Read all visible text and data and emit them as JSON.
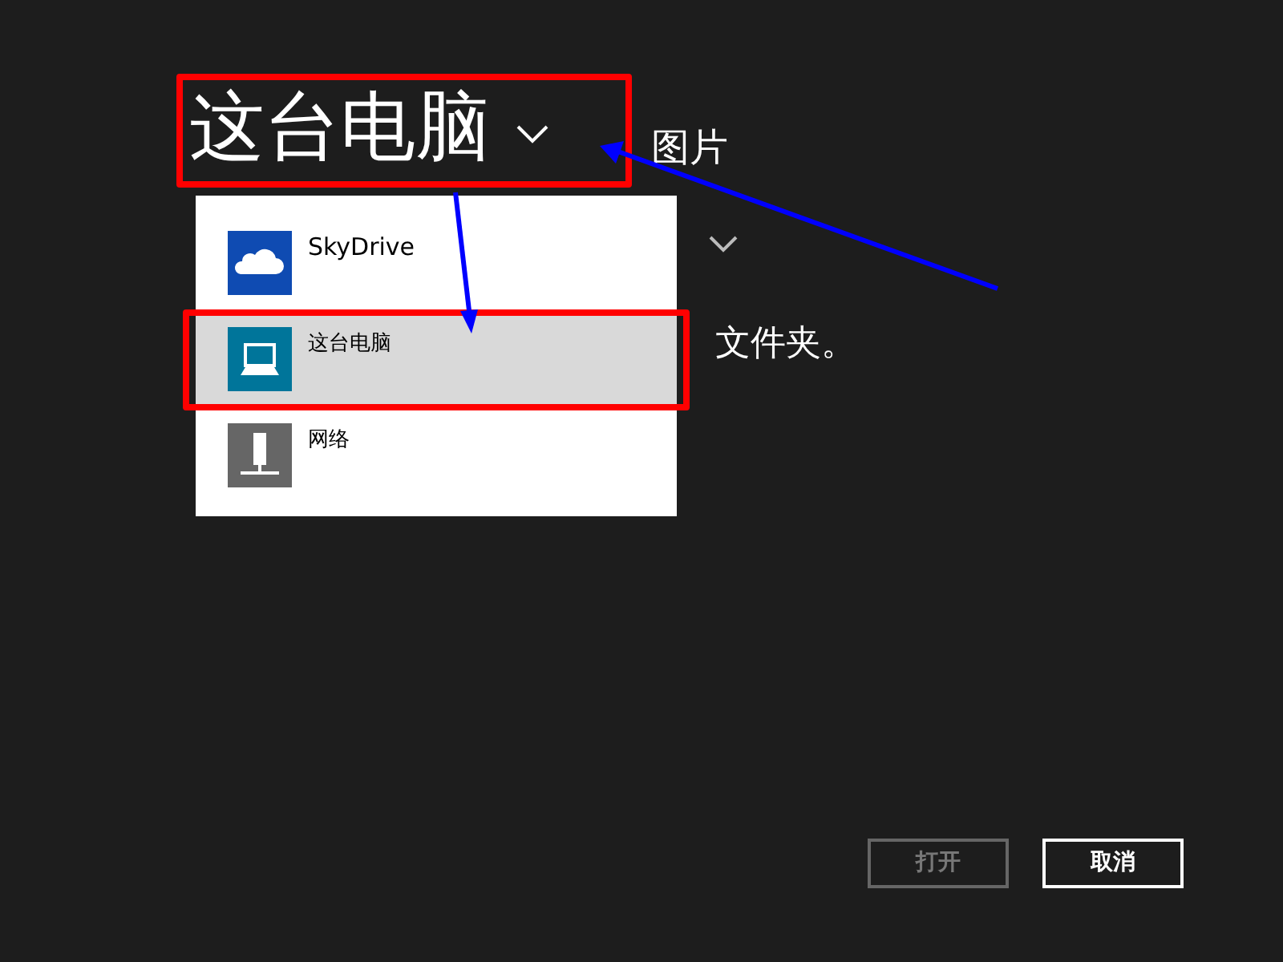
{
  "location": {
    "title": "这台电脑",
    "subfolder": "图片"
  },
  "content_behind": {
    "text": "文件夹。"
  },
  "dropdown": {
    "items": [
      {
        "label": "SkyDrive",
        "kind": "cloud",
        "selected": false
      },
      {
        "label": "这台电脑",
        "kind": "pc",
        "selected": true
      },
      {
        "label": "网络",
        "kind": "network",
        "selected": false
      }
    ]
  },
  "buttons": [
    {
      "label": "打开",
      "disabled": true
    },
    {
      "label": "取消",
      "disabled": false
    }
  ]
}
